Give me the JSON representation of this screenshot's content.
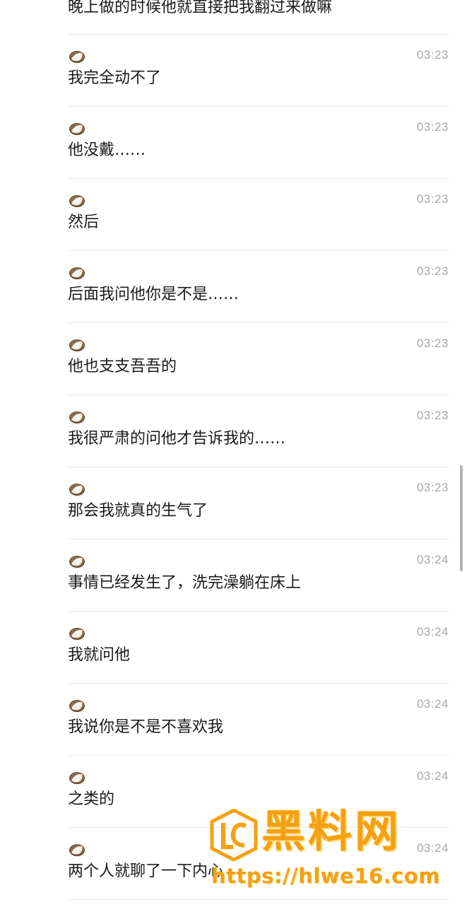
{
  "avatar_icon": "coconut-icon",
  "colors": {
    "text": "#1a1a1a",
    "time": "#a8a8a8",
    "divider": "#e8e8e8",
    "watermark": "#f5a012"
  },
  "messages": {
    "top_partial": "晚上做的时候他就直接把我翻过来做嘛",
    "items": [
      {
        "time": "03:23",
        "text": "我完全动不了"
      },
      {
        "time": "03:23",
        "text": "他没戴……"
      },
      {
        "time": "03:23",
        "text": "然后"
      },
      {
        "time": "03:23",
        "text": "后面我问他你是不是……"
      },
      {
        "time": "03:23",
        "text": "他也支支吾吾的"
      },
      {
        "time": "03:23",
        "text": "我很严肃的问他才告诉我的……"
      },
      {
        "time": "03:23",
        "text": "那会我就真的生气了"
      },
      {
        "time": "03:24",
        "text": "事情已经发生了，洗完澡躺在床上"
      },
      {
        "time": "03:24",
        "text": "我就问他"
      },
      {
        "time": "03:24",
        "text": "我说你是不是不喜欢我"
      },
      {
        "time": "03:24",
        "text": "之类的"
      },
      {
        "time": "03:24",
        "text": "两个人就聊了一下内心"
      }
    ]
  },
  "watermark": {
    "title": "黑料网",
    "url": "https://hlwe16.com"
  }
}
